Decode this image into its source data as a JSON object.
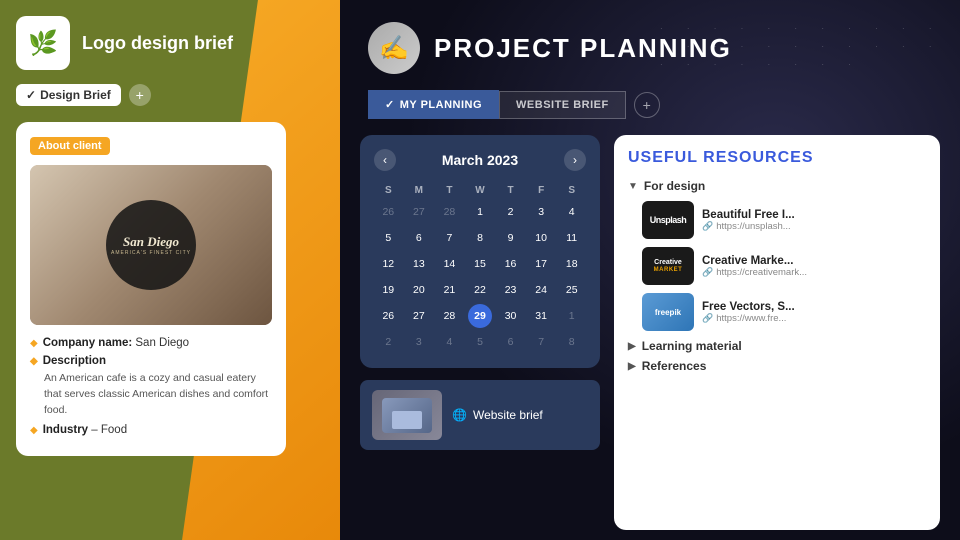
{
  "left": {
    "logo_title": "Logo design brief",
    "logo_icon": "🌿",
    "tab_label": "Design Brief",
    "tab_check": "✓",
    "add_icon": "+",
    "about_badge": "About client",
    "company_label": "Company name:",
    "company_value": "San Diego",
    "description_label": "Description",
    "description_text": "An American cafe is a cozy and casual eatery that serves classic American dishes and comfort food.",
    "industry_label": "Industry",
    "industry_value": "Food",
    "sign_main": "San Diego",
    "sign_sub": "America's Finest City"
  },
  "right": {
    "project_title": "PROJECT PLANNING",
    "tab1_check": "✓",
    "tab1_label": "MY PLANNING",
    "tab2_label": "WEBSITE BRIEF",
    "add_tab_icon": "+",
    "calendar": {
      "month": "March 2023",
      "prev_icon": "‹",
      "next_icon": "›",
      "day_headers": [
        "S",
        "M",
        "T",
        "W",
        "T",
        "F",
        "S"
      ],
      "weeks": [
        [
          {
            "label": "26",
            "type": "other"
          },
          {
            "label": "27",
            "type": "other"
          },
          {
            "label": "28",
            "type": "other"
          },
          {
            "label": "1",
            "type": "normal"
          },
          {
            "label": "2",
            "type": "normal"
          },
          {
            "label": "3",
            "type": "normal"
          },
          {
            "label": "4",
            "type": "normal"
          }
        ],
        [
          {
            "label": "5",
            "type": "normal"
          },
          {
            "label": "6",
            "type": "normal"
          },
          {
            "label": "7",
            "type": "normal"
          },
          {
            "label": "8",
            "type": "normal"
          },
          {
            "label": "9",
            "type": "normal"
          },
          {
            "label": "10",
            "type": "normal"
          },
          {
            "label": "11",
            "type": "normal"
          }
        ],
        [
          {
            "label": "12",
            "type": "normal"
          },
          {
            "label": "13",
            "type": "normal"
          },
          {
            "label": "14",
            "type": "normal"
          },
          {
            "label": "15",
            "type": "normal"
          },
          {
            "label": "16",
            "type": "normal"
          },
          {
            "label": "17",
            "type": "normal"
          },
          {
            "label": "18",
            "type": "normal"
          }
        ],
        [
          {
            "label": "19",
            "type": "normal"
          },
          {
            "label": "20",
            "type": "normal"
          },
          {
            "label": "21",
            "type": "normal"
          },
          {
            "label": "22",
            "type": "normal"
          },
          {
            "label": "23",
            "type": "normal"
          },
          {
            "label": "24",
            "type": "normal"
          },
          {
            "label": "25",
            "type": "normal"
          }
        ],
        [
          {
            "label": "26",
            "type": "normal"
          },
          {
            "label": "27",
            "type": "normal"
          },
          {
            "label": "28",
            "type": "normal"
          },
          {
            "label": "29",
            "type": "today"
          },
          {
            "label": "30",
            "type": "normal"
          },
          {
            "label": "31",
            "type": "normal"
          },
          {
            "label": "1",
            "type": "other"
          }
        ],
        [
          {
            "label": "2",
            "type": "other"
          },
          {
            "label": "3",
            "type": "other"
          },
          {
            "label": "4",
            "type": "other"
          },
          {
            "label": "5",
            "type": "other"
          },
          {
            "label": "6",
            "type": "other"
          },
          {
            "label": "7",
            "type": "other"
          },
          {
            "label": "8",
            "type": "other"
          }
        ]
      ]
    },
    "website_brief_label": "Website brief",
    "website_brief_icon": "🌐",
    "resources": {
      "title": "USEFUL RESOURCES",
      "category_design": "For design",
      "items": [
        {
          "name": "Beautiful Free I...",
          "url": "https://unsplash...",
          "thumb_label": "Unsplash",
          "thumb_type": "unsplash"
        },
        {
          "name": "Creative Marke...",
          "url": "https://creativemark...",
          "thumb_label": "Creative\nMARKET",
          "thumb_type": "creative"
        },
        {
          "name": "Free Vectors, S...",
          "url": "https://www.fre...",
          "thumb_label": "freepik",
          "thumb_type": "freepik"
        }
      ],
      "category_learning": "Learning material",
      "category_references": "References"
    }
  }
}
